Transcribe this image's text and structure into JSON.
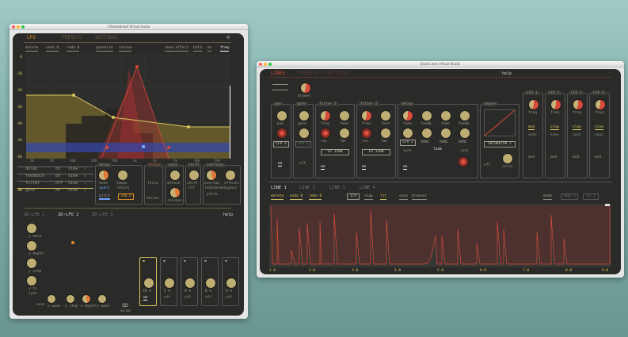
{
  "lfo_window": {
    "title": "Cheesebread Virtual Audio",
    "tabs": [
      "LFO",
      "PRESETS",
      "SETTINGS"
    ],
    "toolbar": [
      "delete",
      "undo 0",
      "redo 0",
      "quantize",
      "rescue",
      "show effect",
      "hold",
      "dx",
      "freq"
    ],
    "y_labels": [
      "0",
      "-10",
      "-20",
      "-30",
      "-40",
      "-50",
      "-60"
    ],
    "x_labels": [
      "20",
      "50",
      "100",
      "200",
      "500",
      "1k",
      "2k",
      "5k",
      "10k",
      "20k"
    ],
    "routes": [
      {
        "name": "delay",
        "state": "on",
        "view": "view"
      },
      {
        "name": "feedback",
        "state": "on",
        "view": "view"
      },
      {
        "name": "filter",
        "state": "off",
        "view": "view"
      },
      {
        "name": "gate",
        "state": "on",
        "view": "view"
      }
    ],
    "route_prefix": "dB",
    "delay_section": {
      "header": "delay",
      "labels": [
        "note",
        "tempo",
        "quant",
        "pitch"
      ],
      "secondary": [
        "sync",
        "return"
      ],
      "value": "100.0"
    },
    "filter_section": {
      "header": "filter",
      "labels": [
        "force"
      ]
    },
    "gate_section": {
      "header": "gate",
      "labels": [
        "attack",
        "stereo",
        "release"
      ]
    },
    "shift_section": {
      "header": "shift",
      "labels": [
        "shift",
        "off"
      ]
    },
    "settings_section": {
      "header": "settings",
      "labels": [
        "overlap",
        "effects",
        "lookahead",
        "bypass",
        "pitch"
      ]
    },
    "lfo_tabs": [
      "2D-LFO 1",
      "2D-LFO 2",
      "2D-LFO 3"
    ],
    "help": "help",
    "lfo_labels": [
      "y wave",
      "y depth",
      "y step",
      "y to",
      "sync"
    ],
    "bottom_knobs": [
      "x wave",
      "x step",
      "x depth",
      "x wave"
    ],
    "bottom_label": "none",
    "slots": [
      {
        "value": "20 %",
        "mode": "on"
      },
      {
        "value": "2 %",
        "mode": "off"
      },
      {
        "value": "0 %",
        "mode": "off"
      },
      {
        "value": "0 %",
        "mode": "off"
      },
      {
        "value": "0 %",
        "mode": "off"
      }
    ],
    "logo_text": "ORLIAN"
  },
  "lines_window": {
    "title": "Quail Lines Virtual Studio",
    "tabs": [
      "LINES",
      "PRESETS",
      "SETTINGS"
    ],
    "help": "help",
    "drywet_label": "drywet",
    "modules": [
      {
        "header": "pan",
        "knobs": [
          "pan"
        ],
        "select": "LFO 2",
        "btn": "on"
      },
      {
        "header": "gate",
        "knobs": [
          "gate"
        ],
        "select": "LFO 1",
        "btn": "off"
      },
      {
        "header": "filter 1",
        "knobs": [
          "freq",
          "feed",
          "res",
          "fat"
        ],
        "select": "LP 12dB",
        "btn": "on"
      },
      {
        "header": "filter 2",
        "knobs": [
          "freq",
          "feed",
          "res",
          "fat"
        ],
        "select": "LP 12dB",
        "btn": "on"
      },
      {
        "header": "delay",
        "knobs": [
          "time",
          "feedb",
          "time",
          "feedb"
        ],
        "select": "LFO 2",
        "extra": [
          "NONE",
          "NONE",
          "NONE",
          "NONE"
        ],
        "link": "link",
        "sync": "sync",
        "btn": "on"
      },
      {
        "header": "shaper",
        "select": "SATURATOR 1",
        "btn": "off",
        "knob": "curve"
      }
    ],
    "side_slots": [
      {
        "header": "LFO 1",
        "labels": [
          "freq",
          "mod",
          "sync",
          "mod"
        ]
      },
      {
        "header": "LFO 2",
        "labels": [
          "freq",
          "slow",
          "sync",
          "mod"
        ]
      },
      {
        "header": "LFO 3",
        "labels": [
          "freq",
          "slow",
          "sync",
          "mod"
        ]
      },
      {
        "header": "LFO 4",
        "labels": [
          "freq",
          "slow",
          "sync",
          "mod"
        ]
      }
    ],
    "line_tabs": [
      "LINE 1",
      "LINE 2",
      "LINE 3",
      "LINE 4"
    ],
    "line_toolbar": [
      "delete",
      "undo 0",
      "redo 0",
      "1/4",
      "snap",
      "fit",
      "save",
      "browser",
      "mode",
      "chan 1",
      "cc 1"
    ],
    "x_axis": [
      "1.0",
      "2.0",
      "3.0",
      "4.0",
      "5.0",
      "6.0",
      "7.0",
      "8.0",
      "9.0"
    ]
  },
  "colors": {
    "accent": "#e0902a",
    "yellow": "#d8c860",
    "red": "#d64b3a",
    "panel": "#2a2a28"
  }
}
